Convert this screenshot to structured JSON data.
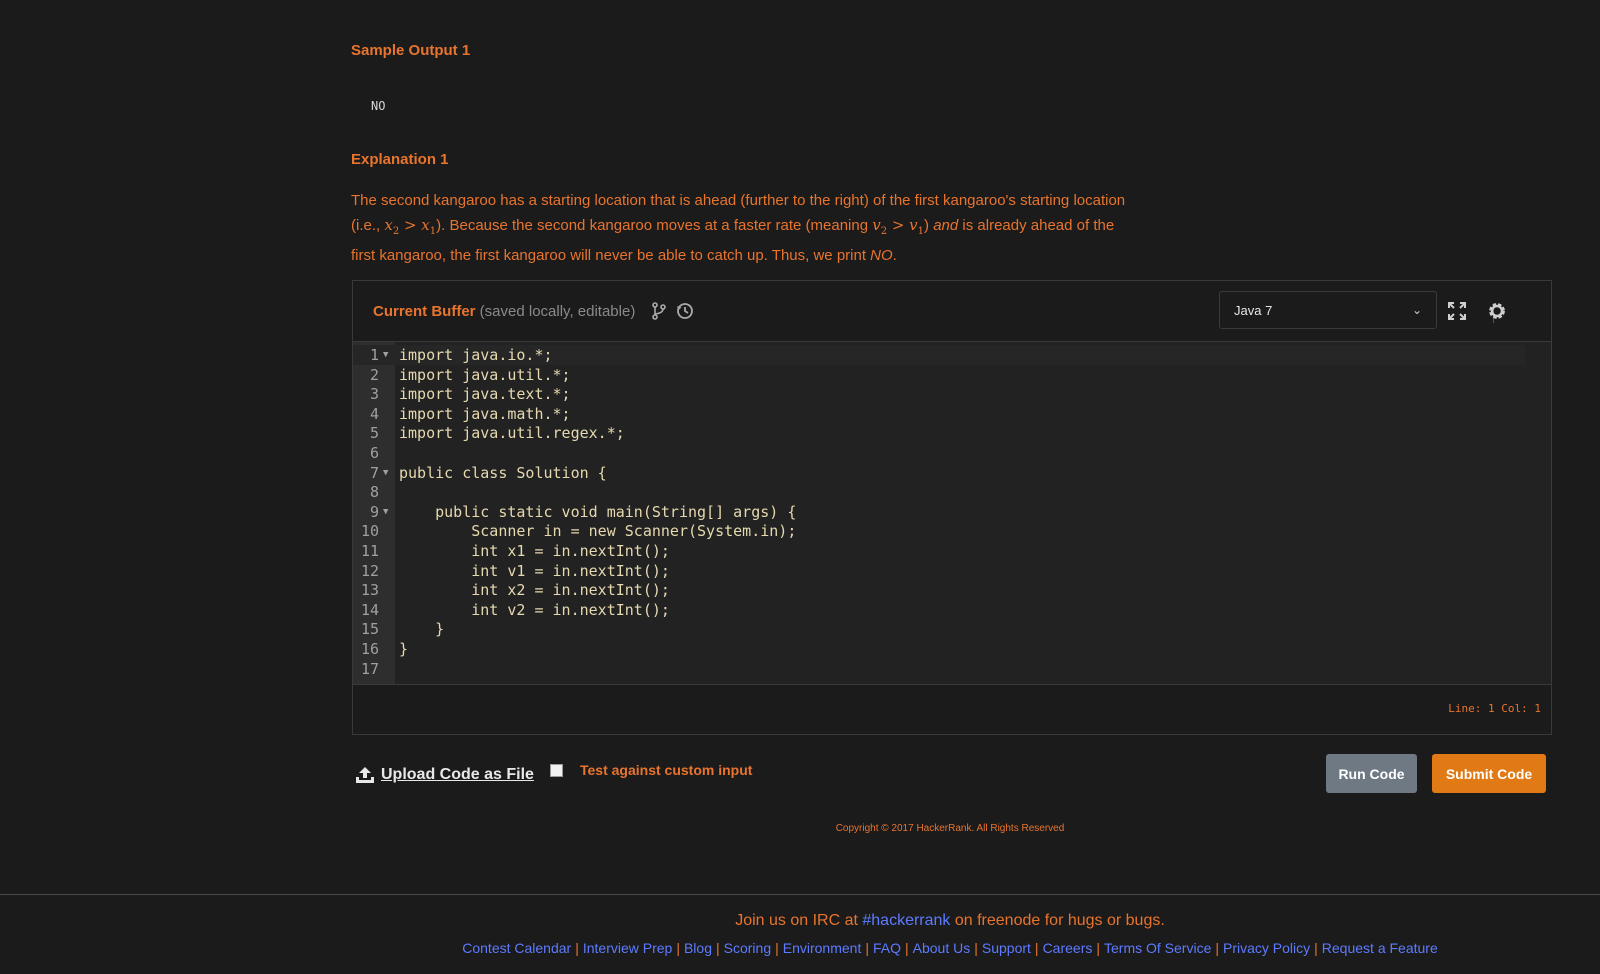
{
  "problem": {
    "sample_output_title": "Sample Output 1",
    "sample_output_value": "NO",
    "explanation_title": "Explanation 1",
    "explanation_part1": "The second kangaroo has a starting location that is ahead (further to the right) of the first kangaroo's starting location (i.e., ",
    "math1": "x",
    "math1_sub": "2",
    "math1_rel": " > x",
    "math1_sub2": "1",
    "explanation_part2": "). Because the second kangaroo moves at a faster rate (meaning ",
    "math2": "v",
    "math2_sub": "2",
    "math2_rel": " > v",
    "math2_sub2": "1",
    "explanation_part3": ") ",
    "explanation_and": "and",
    "explanation_part4": " is already ahead of the first kangaroo, the first kangaroo will never be able to catch up. Thus, we print ",
    "explanation_no": "NO",
    "explanation_end": "."
  },
  "editor": {
    "title": "Current Buffer",
    "title_note": " (saved locally, editable)",
    "language": "Java 7",
    "status": "Line: 1 Col: 1",
    "lines": [
      {
        "n": "1",
        "fold": true,
        "text": "import java.io.*;"
      },
      {
        "n": "2",
        "fold": false,
        "text": "import java.util.*;"
      },
      {
        "n": "3",
        "fold": false,
        "text": "import java.text.*;"
      },
      {
        "n": "4",
        "fold": false,
        "text": "import java.math.*;"
      },
      {
        "n": "5",
        "fold": false,
        "text": "import java.util.regex.*;"
      },
      {
        "n": "6",
        "fold": false,
        "text": ""
      },
      {
        "n": "7",
        "fold": true,
        "text": "public class Solution {"
      },
      {
        "n": "8",
        "fold": false,
        "text": ""
      },
      {
        "n": "9",
        "fold": true,
        "text": "    public static void main(String[] args) {"
      },
      {
        "n": "10",
        "fold": false,
        "text": "        Scanner in = new Scanner(System.in);"
      },
      {
        "n": "11",
        "fold": false,
        "text": "        int x1 = in.nextInt();"
      },
      {
        "n": "12",
        "fold": false,
        "text": "        int v1 = in.nextInt();"
      },
      {
        "n": "13",
        "fold": false,
        "text": "        int x2 = in.nextInt();"
      },
      {
        "n": "14",
        "fold": false,
        "text": "        int v2 = in.nextInt();"
      },
      {
        "n": "15",
        "fold": false,
        "text": "    }"
      },
      {
        "n": "16",
        "fold": false,
        "text": "}"
      },
      {
        "n": "17",
        "fold": false,
        "text": ""
      }
    ]
  },
  "actions": {
    "upload_label": "Upload Code as File",
    "custom_input_label": "Test against custom input",
    "run_label": "Run Code",
    "submit_label": "Submit Code"
  },
  "footer": {
    "copyright": "Copyright © 2017 HackerRank. All Rights Reserved",
    "irc_prefix": "Join us on IRC at ",
    "irc_channel": "#hackerrank",
    "irc_suffix": " on freenode for hugs or bugs.",
    "links": [
      "Contest Calendar",
      "Interview Prep",
      "Blog",
      "Scoring",
      "Environment",
      "FAQ",
      "About Us",
      "Support",
      "Careers",
      "Terms Of Service",
      "Privacy Policy",
      "Request a Feature"
    ]
  },
  "colors": {
    "accent": "#e8742e",
    "link": "#5d7bff",
    "submit": "#e17a14",
    "run": "#6f7984"
  }
}
